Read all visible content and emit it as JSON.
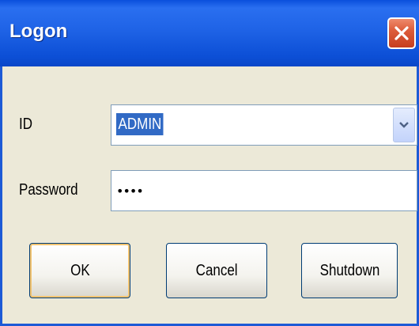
{
  "window": {
    "title": "Logon",
    "close_icon": "close-icon"
  },
  "form": {
    "id_label": "ID",
    "id_value": "ADMIN",
    "password_label": "Password",
    "password_value": "••••"
  },
  "buttons": {
    "ok": "OK",
    "cancel": "Cancel",
    "shutdown": "Shutdown"
  },
  "colors": {
    "titlebar": "#1f63e6",
    "close": "#dd5c3a",
    "dialog_bg": "#ece9d8",
    "selection": "#316ac5"
  }
}
